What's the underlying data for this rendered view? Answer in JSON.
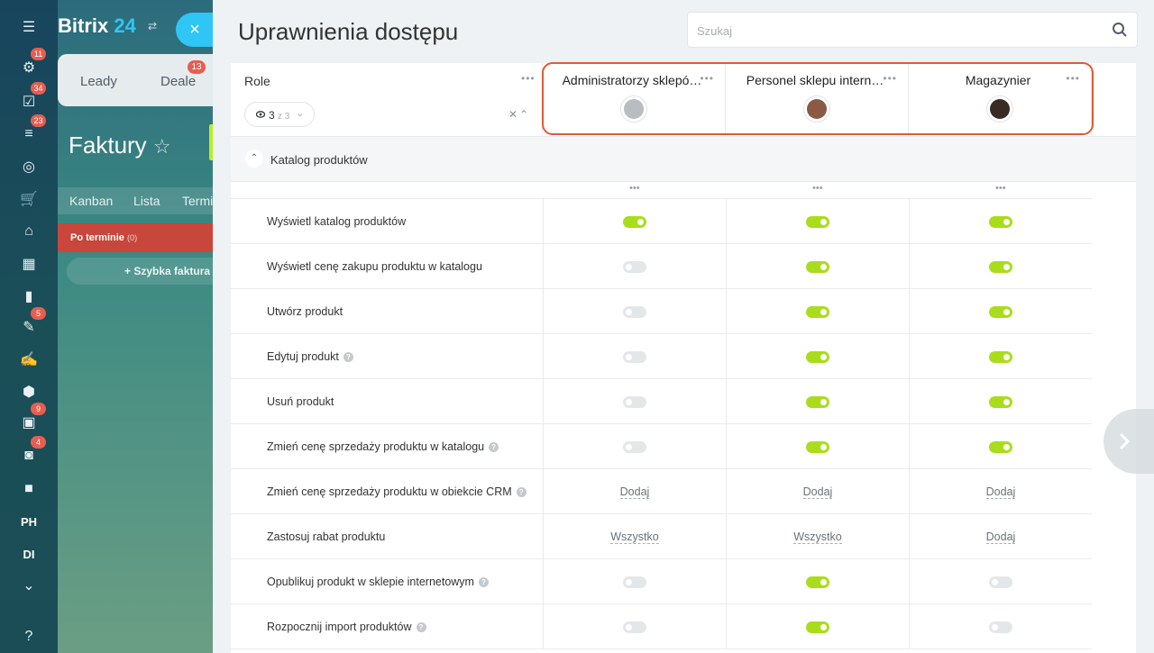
{
  "background": {
    "brand_name": "Bitrix",
    "brand_num": "24",
    "tabs": [
      {
        "label": "Leady"
      },
      {
        "label": "Deale",
        "badge": "13"
      }
    ],
    "page_title": "Faktury",
    "views": [
      "Kanban",
      "Lista",
      "Termi"
    ],
    "stage_label": "Po terminie",
    "stage_count": "(0)",
    "quick_add": "+  Szybka faktura"
  },
  "sidebar": {
    "items": [
      {
        "icon": "menu-icon",
        "badge": ""
      },
      {
        "icon": "feed-icon",
        "badge": "11"
      },
      {
        "icon": "tasks-icon",
        "badge": "34"
      },
      {
        "icon": "crm-icon",
        "badge": "23"
      },
      {
        "icon": "target-icon",
        "badge": ""
      },
      {
        "icon": "cart-icon",
        "badge": ""
      },
      {
        "icon": "bank-icon",
        "badge": ""
      },
      {
        "icon": "calendar-icon",
        "badge": ""
      },
      {
        "icon": "analytics-icon",
        "badge": ""
      },
      {
        "icon": "document-icon",
        "badge": "5"
      },
      {
        "icon": "signature-icon",
        "badge": ""
      },
      {
        "icon": "hexagon-icon",
        "badge": ""
      },
      {
        "icon": "contact-icon",
        "badge": "9"
      },
      {
        "icon": "robot-icon",
        "badge": "4"
      },
      {
        "icon": "box-icon",
        "badge": ""
      },
      {
        "icon": "text",
        "text": "PH",
        "badge": ""
      },
      {
        "icon": "text",
        "text": "DI",
        "badge": ""
      },
      {
        "icon": "more-icon",
        "badge": ""
      },
      {
        "icon": "help-icon",
        "badge": ""
      }
    ]
  },
  "panel": {
    "title": "Uprawnienia dostępu",
    "search_placeholder": "Szukaj",
    "role_label": "Role",
    "counter_shown": "3",
    "counter_total": "z 3",
    "roles": [
      {
        "name": "Administratorzy sklepó…",
        "avatar_color": "#b8bdc2"
      },
      {
        "name": "Personel sklepu intern…",
        "avatar_color": "#8a5a44"
      },
      {
        "name": "Magazynier",
        "avatar_color": "#3a2a24"
      }
    ],
    "section_title": "Katalog produktów",
    "permissions": [
      {
        "label": "Wyświetl katalog produktów",
        "help": false,
        "values": [
          "on",
          "on",
          "on"
        ]
      },
      {
        "label": "Wyświetl cenę zakupu produktu w katalogu",
        "help": false,
        "values": [
          "off",
          "on",
          "on"
        ]
      },
      {
        "label": "Utwórz produkt",
        "help": false,
        "values": [
          "off",
          "on",
          "on"
        ]
      },
      {
        "label": "Edytuj produkt",
        "help": true,
        "values": [
          "off",
          "on",
          "on"
        ]
      },
      {
        "label": "Usuń produkt",
        "help": false,
        "values": [
          "off",
          "on",
          "on"
        ]
      },
      {
        "label": "Zmień cenę sprzedaży produktu w katalogu",
        "help": true,
        "values": [
          "off",
          "on",
          "on"
        ]
      },
      {
        "label": "Zmień cenę sprzedaży produktu w obiekcie CRM",
        "help": true,
        "values": [
          "Dodaj",
          "Dodaj",
          "Dodaj"
        ]
      },
      {
        "label": "Zastosuj rabat produktu",
        "help": false,
        "values": [
          "Wszystko",
          "Wszystko",
          "Dodaj"
        ]
      },
      {
        "label": "Opublikuj produkt w sklepie internetowym",
        "help": true,
        "values": [
          "off",
          "on",
          "off"
        ]
      },
      {
        "label": "Rozpocznij import produktów",
        "help": true,
        "values": [
          "off",
          "on",
          "off"
        ]
      }
    ]
  }
}
